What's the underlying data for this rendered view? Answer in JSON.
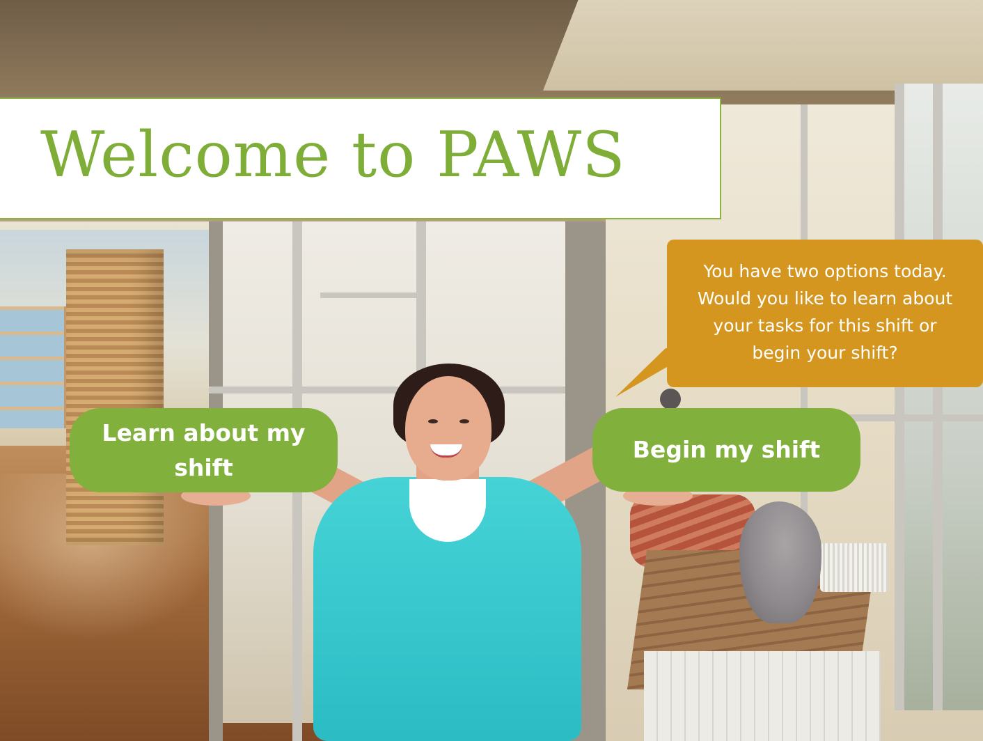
{
  "title": "Welcome to PAWS",
  "speech_bubble": {
    "lines": [
      "You have two options today.",
      "Would you like to learn about",
      "your tasks for this shift or",
      "begin your shift?"
    ]
  },
  "buttons": {
    "learn_label": "Learn about my shift",
    "begin_label": "Begin my shift"
  },
  "colors": {
    "accent_green": "#7eae38",
    "button_green": "#82b03c",
    "bubble_gold": "#d5961f"
  }
}
